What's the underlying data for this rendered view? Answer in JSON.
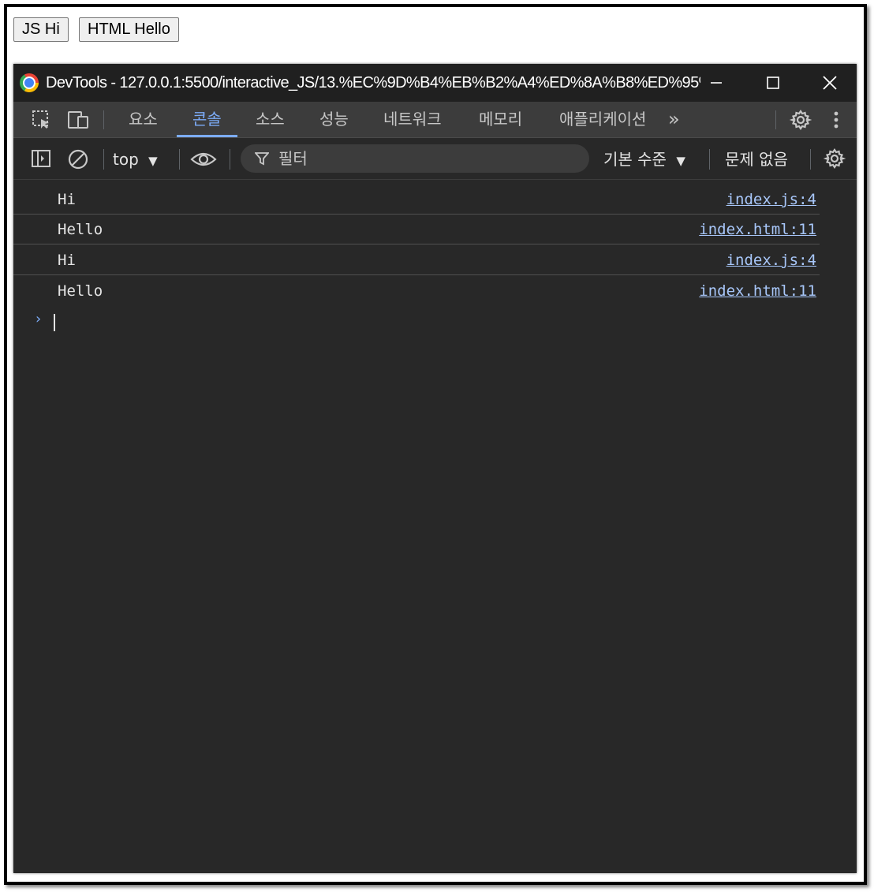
{
  "page": {
    "buttons": [
      {
        "label": "JS Hi"
      },
      {
        "label": "HTML Hello"
      }
    ]
  },
  "devtools": {
    "window_title": "DevTools - 127.0.0.1:5500/interactive_JS/13.%EC%9D%B4%EB%B2%A4%ED%8A%B8%ED%95%...",
    "tabs": [
      {
        "label": "요소"
      },
      {
        "label": "콘솔",
        "active": true
      },
      {
        "label": "소스"
      },
      {
        "label": "성능"
      },
      {
        "label": "네트워크"
      },
      {
        "label": "메모리"
      },
      {
        "label": "애플리케이션"
      }
    ],
    "more_tabs_glyph": "»",
    "console_toolbar": {
      "context": "top",
      "filter_placeholder": "필터",
      "log_level": "기본 수준",
      "issues": "문제 없음"
    },
    "messages": [
      {
        "text": "Hi",
        "source": "index.js:4"
      },
      {
        "text": "Hello",
        "source": "index.html:11"
      },
      {
        "text": "Hi",
        "source": "index.js:4"
      },
      {
        "text": "Hello",
        "source": "index.html:11"
      }
    ],
    "prompt_glyph": "›"
  },
  "colors": {
    "accent": "#7cacf8",
    "link": "#a8c7fa",
    "panel_bg": "#282828",
    "toolbar_bg": "#3c3c3c",
    "titlebar_bg": "#202020"
  }
}
